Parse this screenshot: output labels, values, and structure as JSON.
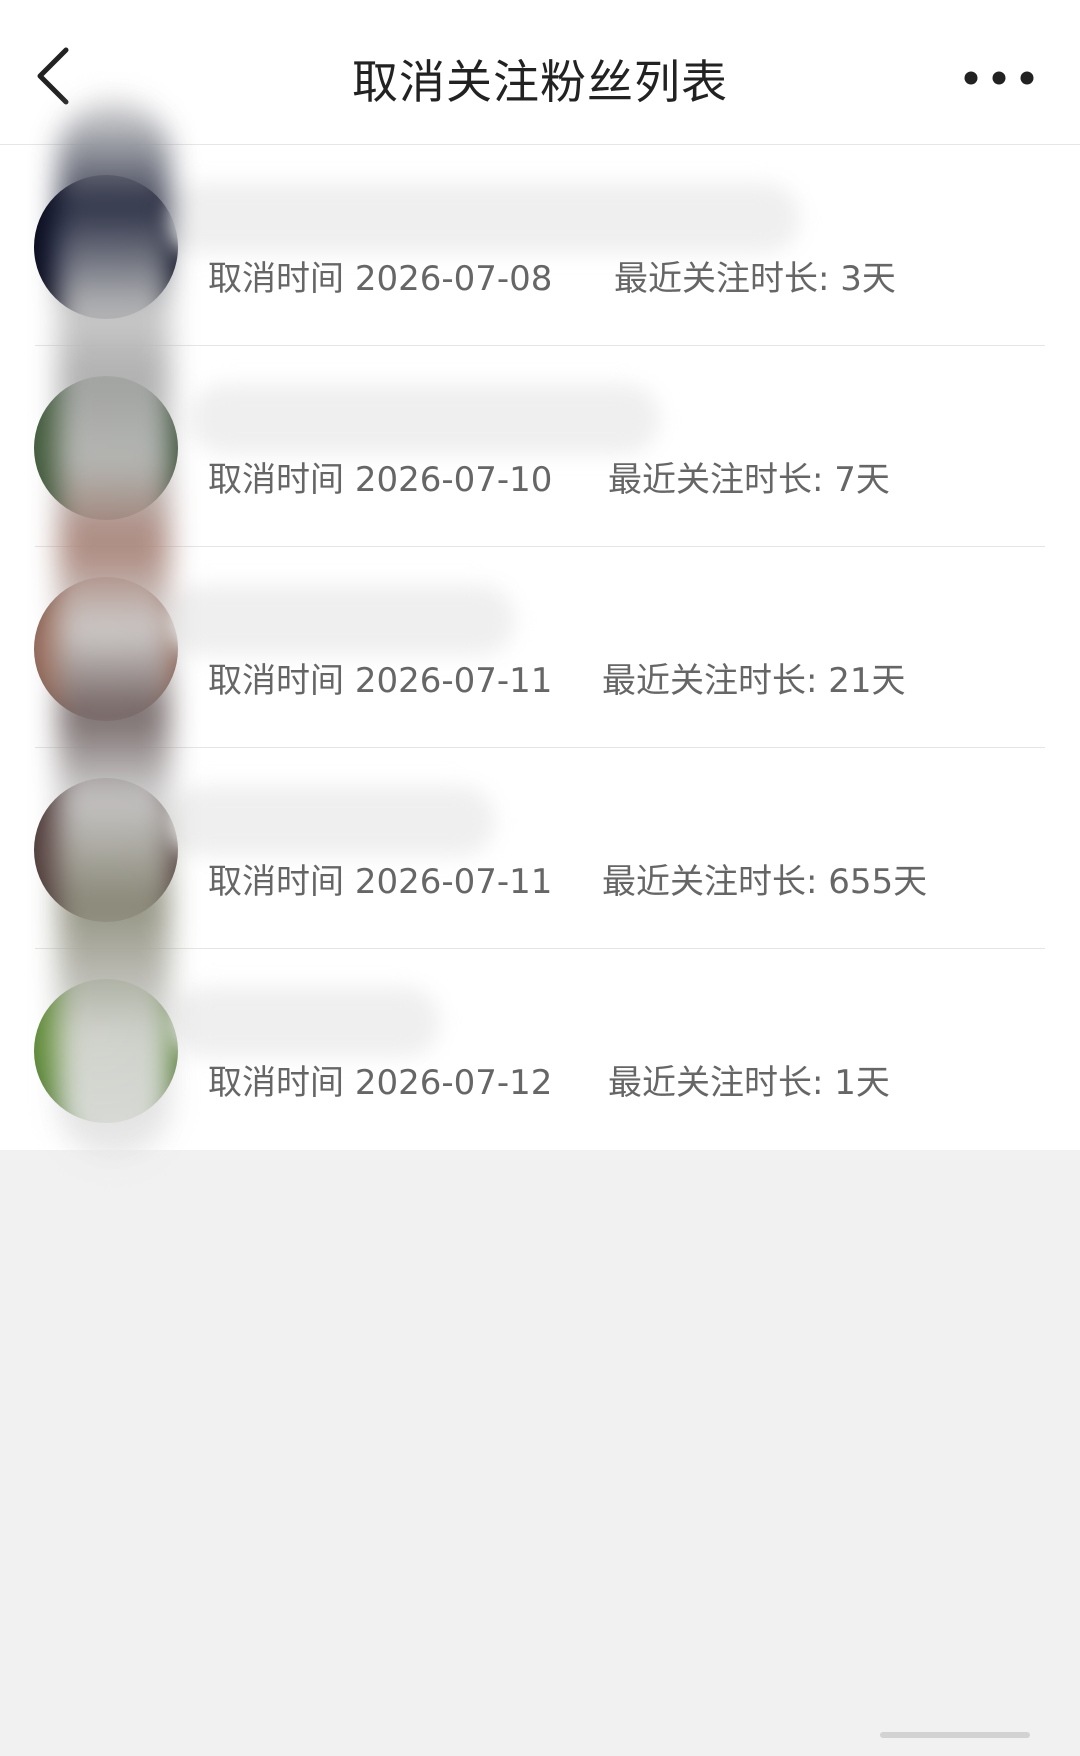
{
  "nav": {
    "title": "取消关注粉丝列表"
  },
  "icons": {
    "back": "chevron-left-icon",
    "more": "more-dots-icon"
  },
  "rows": [
    {
      "cancel_label": "取消时间",
      "cancel_date": "2026-07-08",
      "duration_label": "最近关注时长:",
      "duration_value": "3天"
    },
    {
      "cancel_label": "取消时间",
      "cancel_date": "2026-07-10",
      "duration_label": "最近关注时长:",
      "duration_value": "7天"
    },
    {
      "cancel_label": "取消时间",
      "cancel_date": "2026-07-11",
      "duration_label": "最近关注时长:",
      "duration_value": "21天"
    },
    {
      "cancel_label": "取消时间",
      "cancel_date": "2026-07-11",
      "duration_label": "最近关注时长:",
      "duration_value": "655天"
    },
    {
      "cancel_label": "取消时间",
      "cancel_date": "2026-07-12",
      "duration_label": "最近关注时长:",
      "duration_value": "1天"
    }
  ],
  "colors": {
    "nav_bg": "#ffffff",
    "page_bg": "#f1f1f1",
    "title_text": "#222222",
    "meta_text": "#666666",
    "divider": "#e5e5e5"
  }
}
